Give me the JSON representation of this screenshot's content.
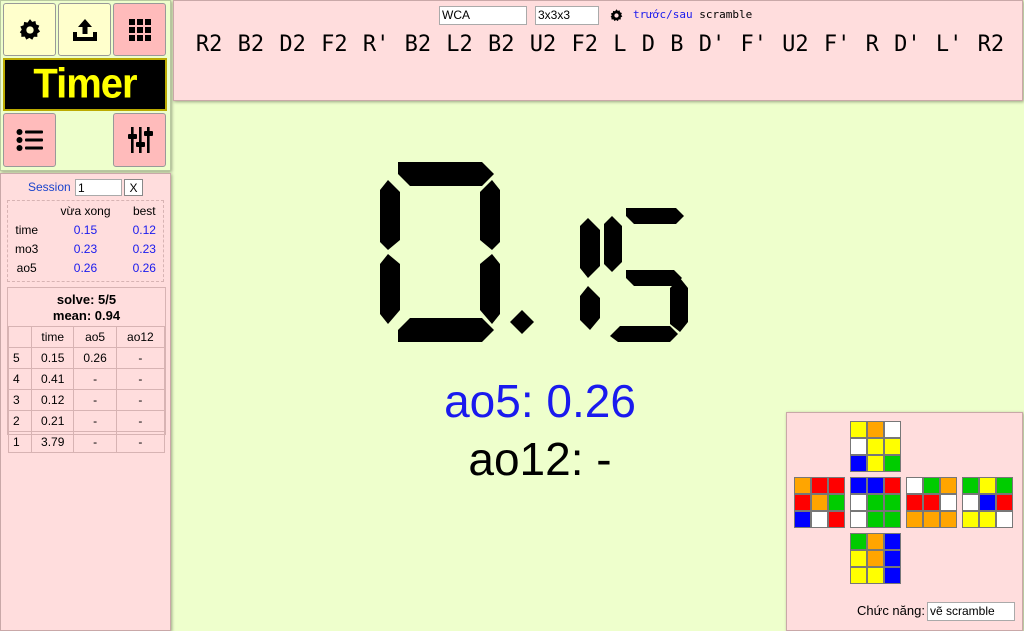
{
  "logo": "Timer",
  "toolbar": {
    "settings_icon": "gear-icon",
    "export_icon": "upload-icon",
    "grid_icon": "grid-icon",
    "list_icon": "list-icon",
    "sliders_icon": "sliders-icon"
  },
  "session": {
    "label": "Session",
    "value": "1",
    "close": "X"
  },
  "stats": {
    "headers": [
      "",
      "vừa xong",
      "best"
    ],
    "rows": [
      {
        "label": "time",
        "current": "0.15",
        "best": "0.12"
      },
      {
        "label": "mo3",
        "current": "0.23",
        "best": "0.23"
      },
      {
        "label": "ao5",
        "current": "0.26",
        "best": "0.26"
      }
    ]
  },
  "summary": {
    "solve": "solve: 5/5",
    "mean": "mean: 0.94",
    "headers": [
      "",
      "time",
      "ao5",
      "ao12"
    ],
    "rows": [
      {
        "idx": "5",
        "time": "0.15",
        "ao5": "0.26",
        "ao12": "-"
      },
      {
        "idx": "4",
        "time": "0.41",
        "ao5": "-",
        "ao12": "-"
      },
      {
        "idx": "3",
        "time": "0.12",
        "ao5": "-",
        "ao12": "-"
      },
      {
        "idx": "2",
        "time": "0.21",
        "ao5": "-",
        "ao12": "-"
      },
      {
        "idx": "1",
        "time": "3.79",
        "ao5": "-",
        "ao12": "-"
      }
    ]
  },
  "scramble": {
    "type_select": "WCA",
    "puzzle_select": "3x3x3",
    "link_prev_next": "trước/sau",
    "link_word": "scramble",
    "text": "R2 B2 D2 F2 R' B2 L2 B2 U2 F2 L D B D' F' U2 F' R D' L' R2"
  },
  "timer": {
    "display": "0.15",
    "ao5": "ao5: 0.26",
    "ao12": "ao12: -"
  },
  "cube_net": {
    "faces": {
      "U": [
        "#ffff00",
        "#ffa500",
        "#ffffff",
        "#ffffff",
        "#ffff00",
        "#ffff00",
        "#0000ff",
        "#ffff00",
        "#00cc00"
      ],
      "L": [
        "#ffa500",
        "#ff0000",
        "#ff0000",
        "#ff0000",
        "#ffa500",
        "#00cc00",
        "#0000ff",
        "#ffffff",
        "#ff0000"
      ],
      "F": [
        "#0000ff",
        "#0000ff",
        "#ff0000",
        "#ffffff",
        "#00cc00",
        "#00cc00",
        "#ffffff",
        "#00cc00",
        "#00cc00"
      ],
      "R": [
        "#ffffff",
        "#00cc00",
        "#ffa500",
        "#ff0000",
        "#ff0000",
        "#ffffff",
        "#ffa500",
        "#ffa500",
        "#ffa500"
      ],
      "B": [
        "#00cc00",
        "#ffff00",
        "#00cc00",
        "#ffffff",
        "#0000ff",
        "#ff0000",
        "#ffff00",
        "#ffff00",
        "#ffffff"
      ],
      "D": [
        "#00cc00",
        "#ffa500",
        "#0000ff",
        "#ffff00",
        "#ffa500",
        "#0000ff",
        "#ffff00",
        "#ffff00",
        "#0000ff"
      ]
    }
  },
  "function": {
    "label": "Chức năng:",
    "value": "vẽ scramble"
  }
}
